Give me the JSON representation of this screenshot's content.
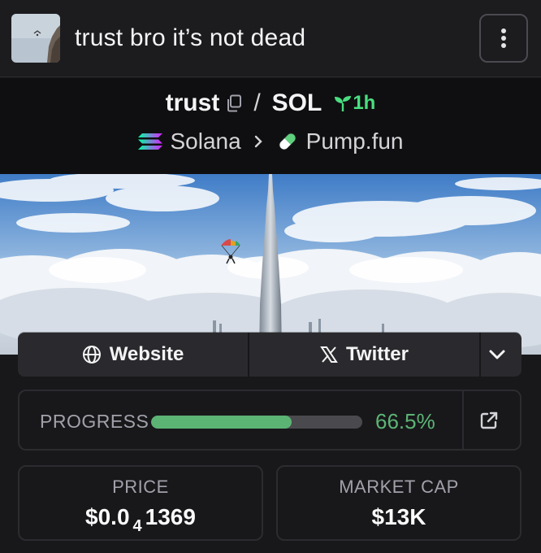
{
  "header": {
    "title": "trust bro it’s not dead",
    "thumbnail_icon": "parachute-cliff-thumbnail",
    "menu_icon": "vertical-dots-icon"
  },
  "pair": {
    "base": "trust",
    "separator": "/",
    "quote": "SOL",
    "age": "1h",
    "copy_icon": "copy-icon",
    "age_icon": "seedling-icon"
  },
  "breadcrumb": {
    "chain": "Solana",
    "chain_icon": "solana-logo-icon",
    "dex": "Pump.fun",
    "dex_icon": "pill-icon"
  },
  "banner": {
    "description_icon": "skydiver-over-tower-banner"
  },
  "links": {
    "website_label": "Website",
    "twitter_label": "Twitter",
    "website_icon": "globe-icon",
    "twitter_icon": "x-logo-icon",
    "more_icon": "chevron-down-icon"
  },
  "progress": {
    "label": "PROGRESS",
    "value_text": "66.5%",
    "fraction": 0.665,
    "color": "#5cb474",
    "link_icon": "external-link-icon"
  },
  "stats": {
    "price_label": "PRICE",
    "price_prefix": "$0.0",
    "price_zeros": "4",
    "price_digits": "1369",
    "mcap_label": "MARKET CAP",
    "mcap_value": "$13K"
  },
  "colors": {
    "background": "#18181b",
    "accent_green": "#4ade80",
    "progress_green": "#5cb474"
  }
}
